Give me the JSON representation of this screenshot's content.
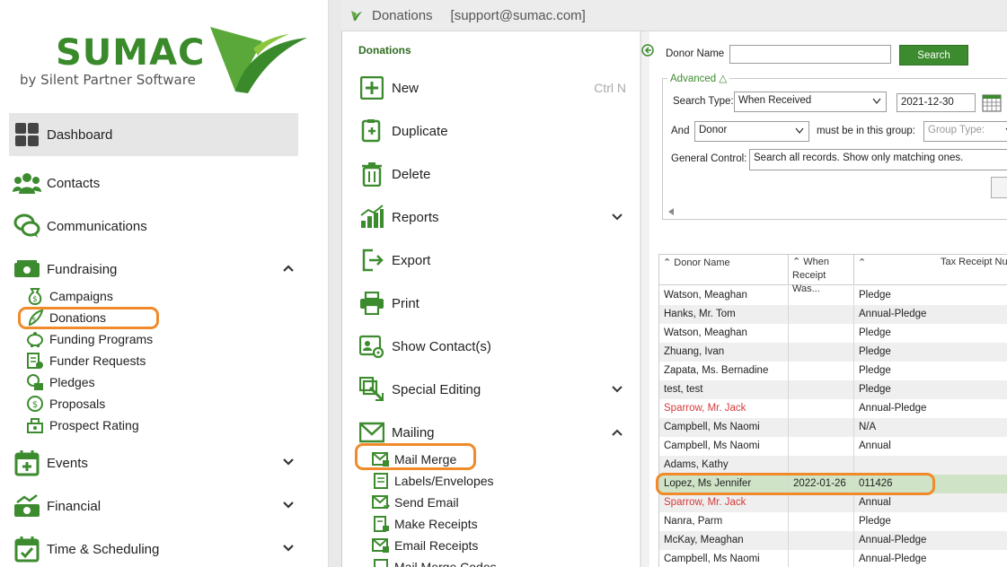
{
  "logo": {
    "word": "SUMAC",
    "sub": "by Silent Partner Software"
  },
  "colors": {
    "brand_green": "#3d8b2f",
    "highlight_orange": "#f08a2a",
    "red_text": "#d63a3a"
  },
  "leftnav": {
    "items": [
      {
        "label": "Dashboard",
        "icon": "dashboard-icon"
      },
      {
        "label": "Contacts",
        "icon": "contacts-icon"
      },
      {
        "label": "Communications",
        "icon": "communications-icon"
      },
      {
        "label": "Fundraising",
        "icon": "fundraising-icon"
      },
      {
        "label": "Events",
        "icon": "events-icon"
      },
      {
        "label": "Financial",
        "icon": "financial-icon"
      },
      {
        "label": "Time & Scheduling",
        "icon": "time-scheduling-icon"
      }
    ],
    "fundraising_sub": [
      {
        "label": "Campaigns"
      },
      {
        "label": "Donations"
      },
      {
        "label": "Funding Programs"
      },
      {
        "label": "Funder Requests"
      },
      {
        "label": "Pledges"
      },
      {
        "label": "Proposals"
      },
      {
        "label": "Prospect Rating"
      }
    ]
  },
  "titlebar": {
    "title": "Donations",
    "account": "[support@sumac.com]"
  },
  "commands": {
    "title": "Donations",
    "items": [
      {
        "label": "New",
        "shortcut": "Ctrl N"
      },
      {
        "label": "Duplicate"
      },
      {
        "label": "Delete"
      },
      {
        "label": "Reports"
      },
      {
        "label": "Export"
      },
      {
        "label": "Print"
      },
      {
        "label": "Show Contact(s)"
      },
      {
        "label": "Special Editing"
      },
      {
        "label": "Mailing"
      }
    ],
    "mailing_sub": [
      {
        "label": "Mail Merge"
      },
      {
        "label": "Labels/Envelopes"
      },
      {
        "label": "Send Email"
      },
      {
        "label": "Make Receipts"
      },
      {
        "label": "Email Receipts"
      },
      {
        "label": "Mail Merge Codes"
      }
    ]
  },
  "search": {
    "donor_name_label": "Donor Name",
    "donor_name_value": "",
    "search_button": "Search",
    "advanced_label": "Advanced △",
    "search_type_label": "Search Type:",
    "search_type_value": "When Received",
    "date_value": "2021-12-30",
    "and_label": "And",
    "and_value": "Donor",
    "group_label": "must be in this group:",
    "group_placeholder": "Group Type:",
    "general_control_label": "General Control:",
    "general_control_value": "Search all records. Show only matching ones."
  },
  "grid": {
    "headers": [
      "Donor Name",
      "When Receipt Was...",
      "Tax Receipt Nu"
    ],
    "rows": [
      {
        "name": "Watson, Meaghan",
        "when": "",
        "tax": "Pledge",
        "red": false
      },
      {
        "name": "Hanks, Mr. Tom",
        "when": "",
        "tax": "Annual-Pledge",
        "red": false
      },
      {
        "name": "Watson, Meaghan",
        "when": "",
        "tax": "Pledge",
        "red": false
      },
      {
        "name": "Zhuang, Ivan",
        "when": "",
        "tax": "Pledge",
        "red": false
      },
      {
        "name": "Zapata, Ms. Bernadine",
        "when": "",
        "tax": "Pledge",
        "red": false
      },
      {
        "name": "test, test",
        "when": "",
        "tax": "Pledge",
        "red": false
      },
      {
        "name": "Sparrow, Mr. Jack",
        "when": "",
        "tax": "Annual-Pledge",
        "red": true
      },
      {
        "name": "Campbell, Ms Naomi",
        "when": "",
        "tax": "N/A",
        "red": false
      },
      {
        "name": "Campbell, Ms Naomi",
        "when": "",
        "tax": "Annual",
        "red": false
      },
      {
        "name": "Adams, Kathy",
        "when": "",
        "tax": "",
        "red": false
      },
      {
        "name": "Lopez, Ms Jennifer",
        "when": "2022-01-26",
        "tax": "011426",
        "red": false
      },
      {
        "name": "Sparrow, Mr. Jack",
        "when": "",
        "tax": "Annual",
        "red": true
      },
      {
        "name": "Nanra, Parm",
        "when": "",
        "tax": "Pledge",
        "red": false
      },
      {
        "name": "McKay, Meaghan",
        "when": "",
        "tax": "Annual-Pledge",
        "red": false
      },
      {
        "name": "Campbell, Ms Naomi",
        "when": "",
        "tax": "Annual-Pledge",
        "red": false
      }
    ]
  }
}
